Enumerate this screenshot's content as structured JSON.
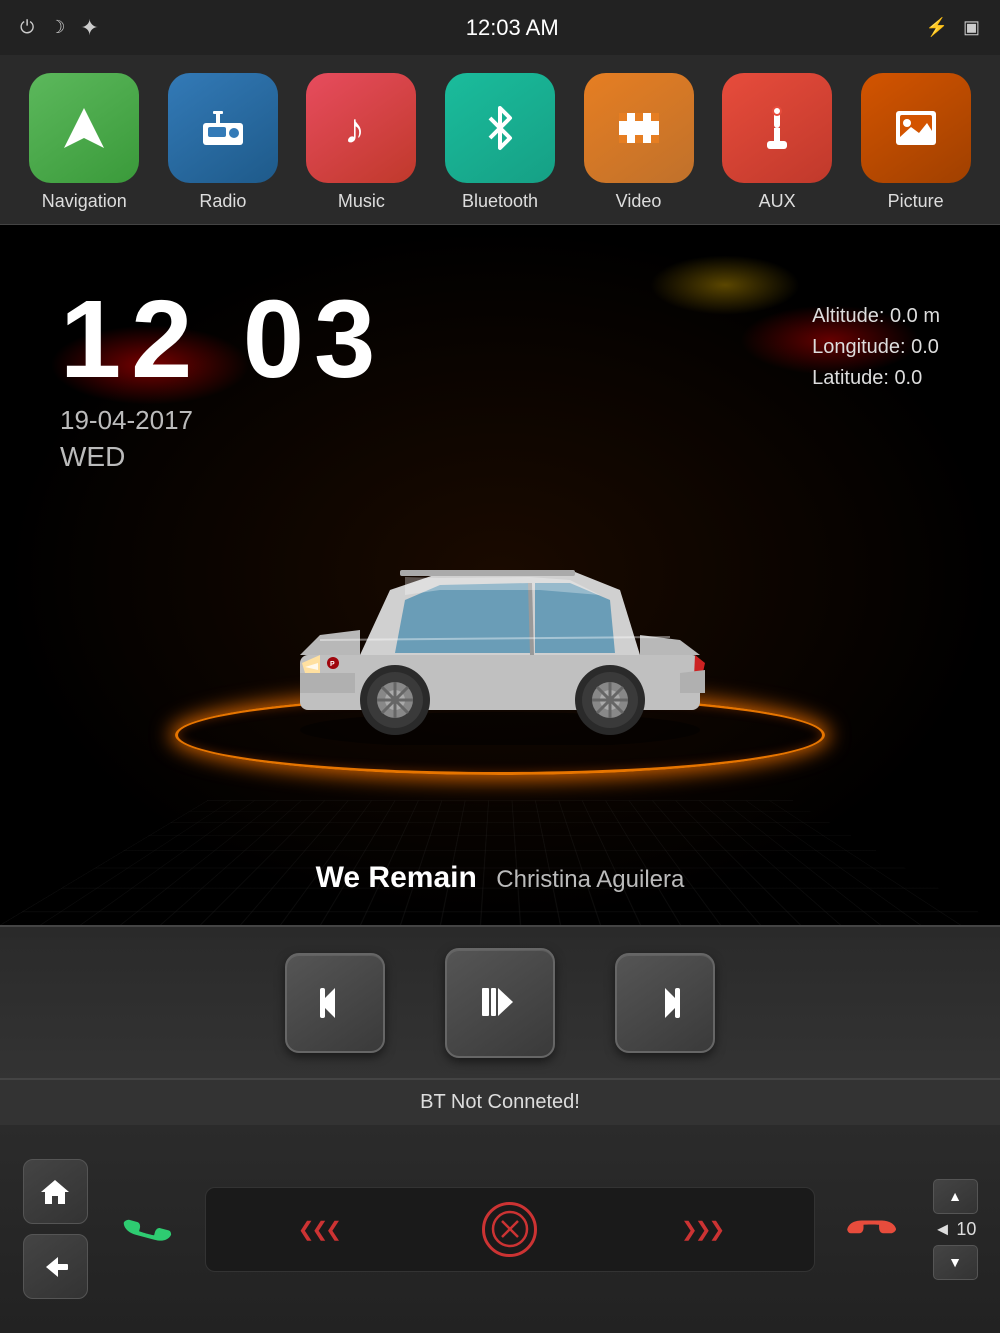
{
  "statusBar": {
    "time": "12:03 AM",
    "powerIcon": "⏻",
    "moonIcon": "☽",
    "sunIcon": "☀",
    "usbIcon": "⚡",
    "screenIcon": "▣"
  },
  "apps": [
    {
      "id": "navigation",
      "label": "Navigation",
      "icon": "▲",
      "colorClass": "icon-nav"
    },
    {
      "id": "radio",
      "label": "Radio",
      "icon": "📻",
      "colorClass": "icon-radio"
    },
    {
      "id": "music",
      "label": "Music",
      "icon": "♪",
      "colorClass": "icon-music"
    },
    {
      "id": "bluetooth",
      "label": "Bluetooth",
      "icon": "⁂",
      "colorClass": "icon-bluetooth"
    },
    {
      "id": "video",
      "label": "Video",
      "icon": "▶",
      "colorClass": "icon-video"
    },
    {
      "id": "aux",
      "label": "AUX",
      "icon": "🔌",
      "colorClass": "icon-aux"
    },
    {
      "id": "picture",
      "label": "Picture",
      "icon": "🖼",
      "colorClass": "icon-picture"
    }
  ],
  "mainDisplay": {
    "timeHour": "12",
    "timeMinute": "03",
    "date": "19-04-2017",
    "day": "WED",
    "altitude": "0.0 m",
    "longitude": "0.0",
    "latitude": "0.0",
    "altitudeLabel": "Altitude:",
    "longitudeLabel": "Longitude:",
    "latitudeLabel": "Latitude:"
  },
  "songInfo": {
    "title": "We Remain",
    "artist": "Christina Aguilera"
  },
  "controls": {
    "prevLabel": "⏮",
    "playPauseLabel": "⏯",
    "nextLabel": "⏭"
  },
  "bottomBar": {
    "btStatus": "BT Not Conneted!",
    "homeIcon": "⌂",
    "backIcon": "←",
    "callIcon": "📞",
    "endCallIcon": "📵",
    "volumeLabel": "◄ 10",
    "volUp": "▲",
    "volDown": "▼"
  }
}
